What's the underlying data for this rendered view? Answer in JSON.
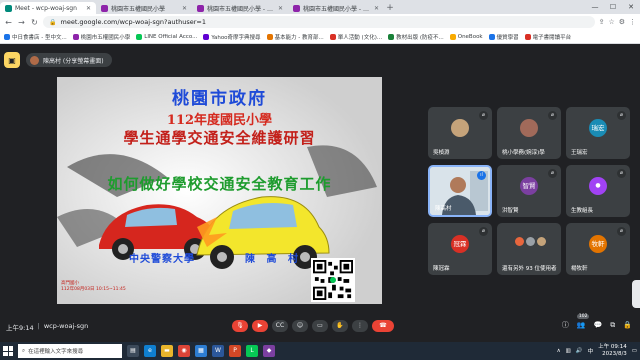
{
  "browser": {
    "tabs": [
      {
        "title": "Meet - wcp-woaj-sgn",
        "color": "#00897b",
        "active": true
      },
      {
        "title": "桃園市五權國民小學",
        "color": "#8e24aa",
        "active": false
      },
      {
        "title": "桃園市五權國民小學 - 112學年",
        "color": "#8e24aa",
        "active": false
      },
      {
        "title": "桃園市五權國民小學 - 本站消息",
        "color": "#8e24aa",
        "active": false
      }
    ],
    "new_tab": "+",
    "url": "meet.google.com/wcp-woaj-sgn?authuser=1",
    "bookmarks": [
      {
        "label": "中日食書店 - 型中文...",
        "color": "#1a73e8"
      },
      {
        "label": "桃園市五權國民小學",
        "color": "#8e24aa"
      },
      {
        "label": "LINE Official Acco...",
        "color": "#06c755"
      },
      {
        "label": "Yahoo奇摩字典搜尋",
        "color": "#6001d2"
      },
      {
        "label": "基本能力 - 教育部...",
        "color": "#e37400"
      },
      {
        "label": "單人活動 (文化)...",
        "color": "#d93025"
      },
      {
        "label": "教材出版 (防疫不...",
        "color": "#188038"
      },
      {
        "label": "OneBook",
        "color": "#f9ab00"
      },
      {
        "label": "優質學習",
        "color": "#1a73e8"
      },
      {
        "label": "電子書閱讀平台",
        "color": "#d93025"
      }
    ]
  },
  "presenter": {
    "label": "陳高村 (分享螢幕畫面)"
  },
  "slide": {
    "title1": "桃園市政府",
    "title2": "112年度國民小學",
    "title3": "學生通學交通安全維護研習",
    "title4": "如何做好學校交通安全教育工作",
    "org": "中央警察大學",
    "speaker": "陳 高 村",
    "note_line1": "高門國小",
    "note_line2": "112年08月03日 10:15~11:45"
  },
  "participants": [
    {
      "name": "吳楨淵",
      "avatar": "",
      "color": "#c5a37a",
      "photo": true
    },
    {
      "name": "桃小學務(婉淳)學",
      "avatar": "",
      "color": "#a16a5a",
      "photo": true
    },
    {
      "name": "王瑞宏",
      "avatar": "瑞宏",
      "color": "#1a8cb5",
      "photo": false
    },
    {
      "name": "陳高村",
      "avatar": "",
      "color": "#d9e3ea",
      "photo": true
    },
    {
      "name": "洪智賢",
      "avatar": "智賢",
      "color": "#7b3fa0",
      "photo": false
    },
    {
      "name": "生教組長",
      "avatar": "",
      "color": "#a142f4",
      "photo": false
    },
    {
      "name": "陳冠霖",
      "avatar": "冠霖",
      "color": "#d93025",
      "photo": false
    },
    {
      "name": "還有另外 93 位使用者",
      "avatar": "",
      "color": "#e8663d",
      "photo": false
    },
    {
      "name": "楊牧軒",
      "avatar": "牧軒",
      "color": "#e37400",
      "photo": false
    }
  ],
  "bottom": {
    "time": "上午9:14",
    "meeting_code": "wcp-woaj-sgn",
    "participant_count": "102"
  },
  "taskbar": {
    "search_placeholder": "在這裡輸入文字來搜尋",
    "clock_time": "上午 09:14",
    "clock_date": "2023/8/3"
  }
}
